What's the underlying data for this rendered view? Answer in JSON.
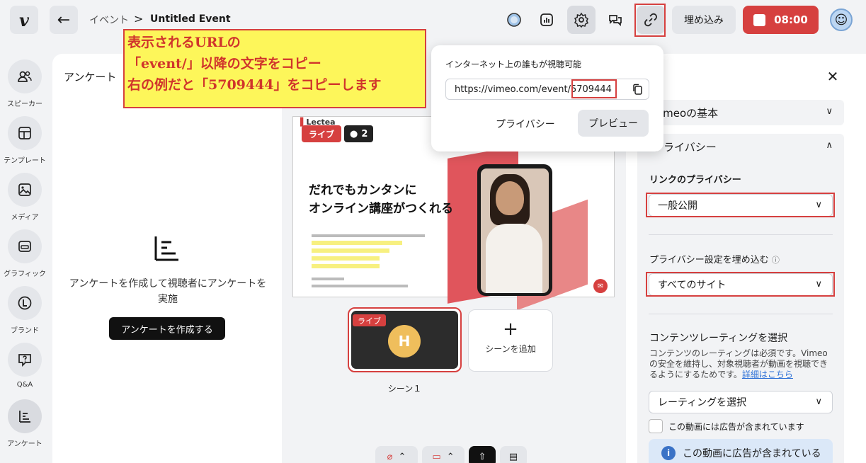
{
  "topbar": {
    "logo_text": "v",
    "breadcrumb_parent": "イベント",
    "breadcrumb_sep": ">",
    "title": "Untitled Event",
    "embed_label": "埋め込み",
    "timer": "08:00"
  },
  "sidebar": {
    "items": [
      {
        "label": "スピーカー",
        "icon": "speakers-icon"
      },
      {
        "label": "テンプレート",
        "icon": "template-icon"
      },
      {
        "label": "メディア",
        "icon": "media-icon"
      },
      {
        "label": "グラフィック",
        "icon": "graphics-icon"
      },
      {
        "label": "ブランド",
        "icon": "brand-icon"
      },
      {
        "label": "Q&A",
        "icon": "qa-icon"
      },
      {
        "label": "アンケート",
        "icon": "poll-icon"
      }
    ]
  },
  "poll": {
    "title": "アンケート",
    "empty_text": "アンケートを作成して視聴者にアンケートを実施",
    "create_button": "アンケートを作成する"
  },
  "preview": {
    "live_tag": "ライブ",
    "viewer_count": "2",
    "slide_brand": "Lectea",
    "slide_headline_1": "だれでもカンタンに",
    "slide_headline_2": "オンライン講座がつくれる"
  },
  "scenes": {
    "scene_live": "ライブ",
    "scene_avatar": "H",
    "scene_label": "シーン１",
    "add_scene": "シーンを追加"
  },
  "popup": {
    "title": "インターネット上の誰もが視聴可能",
    "url_prefix": "https://vimeo.com/event/",
    "url_id": "5709444",
    "privacy": "プライバシー",
    "preview": "プレビュー"
  },
  "annotation": {
    "line1": "表示されるURLの",
    "line2": "「event/」以降の文字をコピー",
    "line3": "右の例だと「5709444」をコピーします"
  },
  "settings": {
    "vimeo_basics": "Vimeoの基本",
    "privacy_section": "プライバシー",
    "link_privacy_label": "リンクのプライバシー",
    "link_privacy_value": "一般公開",
    "embed_privacy_label": "プライバシー設定を埋め込む",
    "embed_privacy_value": "すべてのサイト",
    "rating_label": "コンテンツレーティングを選択",
    "rating_desc": "コンテンツのレーティングは必須です。Vimeoの安全を維持し、対象視聴者が動画を視聴できるようにするためです。",
    "rating_link": "詳細はこちら",
    "rating_select": "レーティングを選択",
    "ads_checkbox": "この動画には広告が含まれています",
    "ads_info": "この動画に広告が含まれている"
  },
  "colors": {
    "accent_red": "#d6403f",
    "annotation_yellow": "#fdf65a",
    "link_blue": "#2b6fd6"
  }
}
